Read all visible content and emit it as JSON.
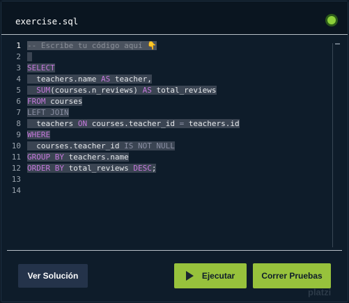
{
  "file": {
    "name": "exercise.sql"
  },
  "editor": {
    "line_numbers": [
      "1",
      "2",
      "3",
      "4",
      "5",
      "6",
      "7",
      "8",
      "9",
      "10",
      "11",
      "12",
      "13",
      "14"
    ],
    "lines": [
      [
        {
          "t": "-- Escribe tu código aquí ",
          "c": "cm"
        },
        {
          "t": "👇",
          "c": "emoji"
        }
      ],
      [
        {
          "t": " ",
          "c": "pl"
        }
      ],
      [
        {
          "t": "SELECT",
          "c": "kw"
        }
      ],
      [
        {
          "t": "  teachers.name ",
          "c": "pl"
        },
        {
          "t": "AS",
          "c": "kw"
        },
        {
          "t": " teacher,",
          "c": "pl"
        }
      ],
      [
        {
          "t": "  ",
          "c": "pl"
        },
        {
          "t": "SUM",
          "c": "kw"
        },
        {
          "t": "(courses.n_reviews) ",
          "c": "pl"
        },
        {
          "t": "AS",
          "c": "kw"
        },
        {
          "t": " total_reviews",
          "c": "pl"
        }
      ],
      [
        {
          "t": "FROM",
          "c": "kw"
        },
        {
          "t": " courses",
          "c": "pl"
        }
      ],
      [
        {
          "t": "LEFT JOIN",
          "c": "kw2"
        }
      ],
      [
        {
          "t": "  teachers ",
          "c": "pl"
        },
        {
          "t": "ON",
          "c": "kw"
        },
        {
          "t": " courses.teacher_id ",
          "c": "pl"
        },
        {
          "t": "=",
          "c": "kw2"
        },
        {
          "t": " teachers.id",
          "c": "pl"
        }
      ],
      [
        {
          "t": "WHERE",
          "c": "kw"
        }
      ],
      [
        {
          "t": "  courses.teacher_id ",
          "c": "pl"
        },
        {
          "t": "IS NOT NULL",
          "c": "kw2"
        }
      ],
      [
        {
          "t": "GROUP BY",
          "c": "kw"
        },
        {
          "t": " teachers.name",
          "c": "pl"
        }
      ],
      [
        {
          "t": "ORDER BY",
          "c": "kw"
        },
        {
          "t": " total_reviews ",
          "c": "pl"
        },
        {
          "t": "DESC",
          "c": "kw"
        },
        {
          "t": ";",
          "c": "pl"
        }
      ],
      [],
      []
    ]
  },
  "buttons": {
    "solution": "Ver Solución",
    "run": "Ejecutar",
    "tests": "Correr Pruebas"
  },
  "watermark": "platzi",
  "colors": {
    "background": "#0e1c2a",
    "accent_green": "#97c23c",
    "status_dot": "#8ccf3a",
    "keyword": "#c678dd"
  }
}
